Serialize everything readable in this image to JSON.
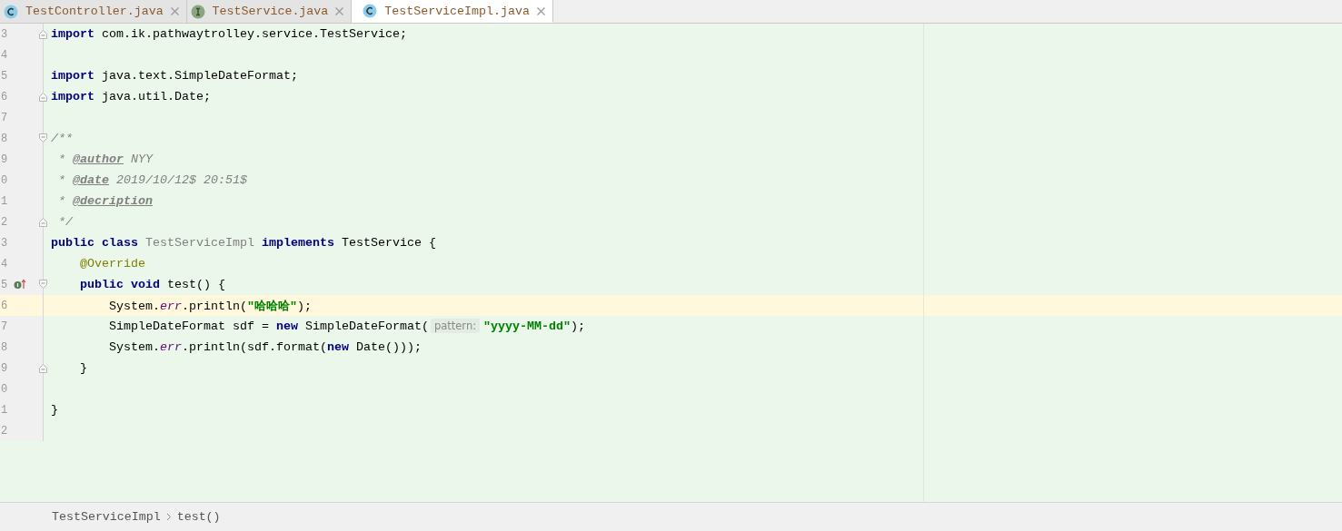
{
  "tabs": [
    {
      "label": "TestController.java",
      "kind": "class",
      "selected": false
    },
    {
      "label": "TestService.java",
      "kind": "interface",
      "selected": false
    },
    {
      "label": "TestServiceImpl.java",
      "kind": "class",
      "selected": true
    }
  ],
  "editor": {
    "lines": [
      {
        "number": "3",
        "current": false,
        "fold_start": false,
        "fold_end": true,
        "implements_mark": false,
        "tokens": [
          {
            "kind": "kw",
            "text": "import"
          },
          {
            "kind": "plain",
            "text": " com.ik.pathwaytrolley.service.TestService;"
          }
        ]
      },
      {
        "number": "4",
        "current": false,
        "fold_start": false,
        "fold_end": false,
        "implements_mark": false
      },
      {
        "number": "5",
        "current": false,
        "fold_start": false,
        "fold_end": false,
        "implements_mark": false,
        "tokens": [
          {
            "kind": "kw",
            "text": "import"
          },
          {
            "kind": "plain",
            "text": " java.text.SimpleDateFormat;"
          }
        ]
      },
      {
        "number": "6",
        "current": false,
        "fold_start": false,
        "fold_end": true,
        "implements_mark": false,
        "tokens": [
          {
            "kind": "kw",
            "text": "import"
          },
          {
            "kind": "plain",
            "text": " java.util.Date;"
          }
        ]
      },
      {
        "number": "7",
        "current": false,
        "fold_start": false,
        "fold_end": false,
        "implements_mark": false
      },
      {
        "number": "8",
        "current": false,
        "fold_start": true,
        "fold_end": false,
        "implements_mark": false,
        "tokens": [
          {
            "kind": "comment",
            "text": "/**"
          }
        ]
      },
      {
        "number": "9",
        "current": false,
        "fold_start": false,
        "fold_end": false,
        "implements_mark": false,
        "tokens": [
          {
            "kind": "comment",
            "text": " * "
          },
          {
            "kind": "doctag",
            "text": "@author"
          },
          {
            "kind": "comment",
            "text": " NYY"
          }
        ]
      },
      {
        "number": "0",
        "current": false,
        "fold_start": false,
        "fold_end": false,
        "implements_mark": false,
        "tokens": [
          {
            "kind": "comment",
            "text": " * "
          },
          {
            "kind": "doctag",
            "text": "@date"
          },
          {
            "kind": "comment",
            "text": " 2019/10/12$ 20:51$"
          }
        ]
      },
      {
        "number": "1",
        "current": false,
        "fold_start": false,
        "fold_end": false,
        "implements_mark": false,
        "tokens": [
          {
            "kind": "comment",
            "text": " * "
          },
          {
            "kind": "doctag",
            "text": "@decription"
          }
        ]
      },
      {
        "number": "2",
        "current": false,
        "fold_start": false,
        "fold_end": true,
        "implements_mark": false,
        "tokens": [
          {
            "kind": "comment",
            "text": " */"
          }
        ]
      },
      {
        "number": "3",
        "current": false,
        "fold_start": false,
        "fold_end": false,
        "implements_mark": false,
        "tokens": [
          {
            "kind": "kw",
            "text": "public class"
          },
          {
            "kind": "unused",
            "text": " TestServiceImpl"
          },
          {
            "kind": "kw",
            "text": " implements"
          },
          {
            "kind": "plain",
            "text": " TestService {"
          }
        ]
      },
      {
        "number": "4",
        "current": false,
        "fold_start": false,
        "fold_end": false,
        "implements_mark": false,
        "tokens": [
          {
            "kind": "ann",
            "text": "    @Override"
          }
        ]
      },
      {
        "number": "5",
        "current": false,
        "fold_start": true,
        "fold_end": false,
        "implements_mark": true,
        "tokens": [
          {
            "kind": "kw",
            "text": "    public void"
          },
          {
            "kind": "plain",
            "text": " test() {"
          }
        ]
      },
      {
        "number": "6",
        "current": true,
        "fold_start": false,
        "fold_end": false,
        "implements_mark": false,
        "tokens": [
          {
            "kind": "plain",
            "text": "        System."
          },
          {
            "kind": "field",
            "text": "err"
          },
          {
            "kind": "plain",
            "text": ".println("
          },
          {
            "kind": "str",
            "text": "\"哈哈哈\""
          },
          {
            "kind": "plain",
            "text": ");"
          }
        ]
      },
      {
        "number": "7",
        "current": false,
        "fold_start": false,
        "fold_end": false,
        "implements_mark": false,
        "tokens": [
          {
            "kind": "plain",
            "text": "        SimpleDateFormat sdf = "
          },
          {
            "kind": "kw",
            "text": "new"
          },
          {
            "kind": "plain",
            "text": " SimpleDateFormat("
          },
          {
            "kind": "hint",
            "text": "pattern:"
          },
          {
            "kind": "str",
            "text": "\"yyyy-MM-dd\""
          },
          {
            "kind": "plain",
            "text": ");"
          }
        ]
      },
      {
        "number": "8",
        "current": false,
        "fold_start": false,
        "fold_end": false,
        "implements_mark": false,
        "tokens": [
          {
            "kind": "plain",
            "text": "        System."
          },
          {
            "kind": "field",
            "text": "err"
          },
          {
            "kind": "plain",
            "text": ".println(sdf.format("
          },
          {
            "kind": "kw",
            "text": "new"
          },
          {
            "kind": "plain",
            "text": " Date()));"
          }
        ]
      },
      {
        "number": "9",
        "current": false,
        "fold_start": false,
        "fold_end": true,
        "implements_mark": false,
        "tokens": [
          {
            "kind": "plain",
            "text": "    }"
          }
        ]
      },
      {
        "number": "0",
        "current": false,
        "fold_start": false,
        "fold_end": false,
        "implements_mark": false
      },
      {
        "number": "1",
        "current": false,
        "fold_start": false,
        "fold_end": false,
        "implements_mark": false,
        "tokens": [
          {
            "kind": "plain",
            "text": "}"
          }
        ]
      },
      {
        "number": "2",
        "current": false,
        "fold_start": false,
        "fold_end": false,
        "implements_mark": false
      }
    ]
  },
  "breadcrumb": [
    "TestServiceImpl",
    "test()"
  ]
}
